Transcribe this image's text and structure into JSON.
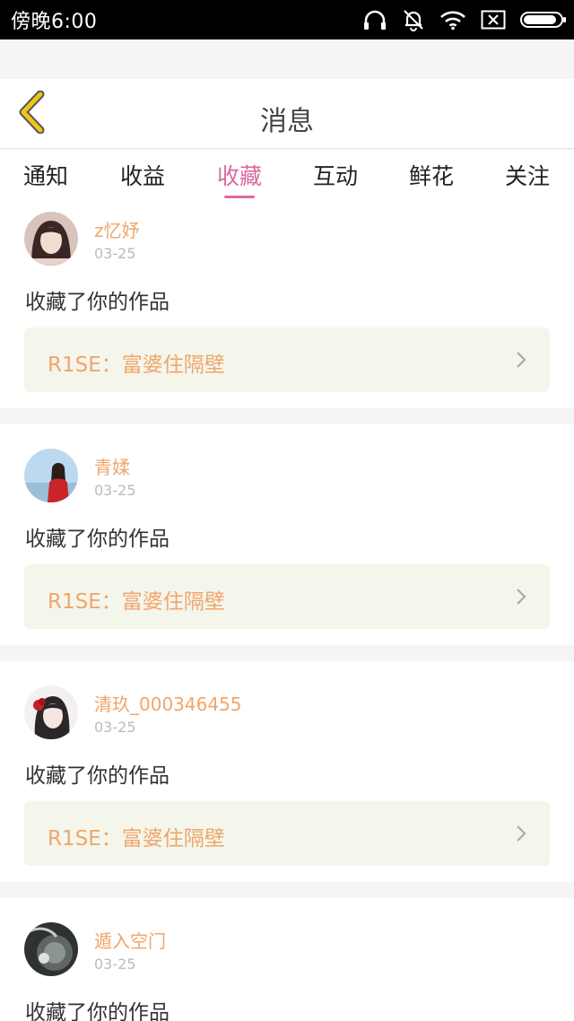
{
  "status_bar": {
    "time": "傍晚6:00",
    "icons": [
      "headphones-icon",
      "bell-muted-icon",
      "wifi-icon",
      "sim-none-icon",
      "battery-icon"
    ],
    "battery_level": 0.9
  },
  "header": {
    "title": "消息",
    "back_icon": "chevron-left-icon",
    "accent": "#f0c419"
  },
  "tabs": [
    {
      "label": "通知",
      "active": false
    },
    {
      "label": "收益",
      "active": false
    },
    {
      "label": "收藏",
      "active": true
    },
    {
      "label": "互动",
      "active": false
    },
    {
      "label": "鲜花",
      "active": false
    },
    {
      "label": "关注",
      "active": false
    }
  ],
  "colors": {
    "tab_active": "#d96aa0",
    "username": "#f0a66a",
    "work_title": "#f0a66a",
    "work_box_bg": "#f4f6ec"
  },
  "messages": [
    {
      "username": "z忆妤",
      "date": "03-25",
      "action": "收藏了你的作品",
      "work_title": "R1SE：富婆住隔壁"
    },
    {
      "username": "青媃",
      "date": "03-25",
      "action": "收藏了你的作品",
      "work_title": "R1SE：富婆住隔壁"
    },
    {
      "username": "清玖_000346455",
      "date": "03-25",
      "action": "收藏了你的作品",
      "work_title": "R1SE：富婆住隔壁"
    },
    {
      "username": "遁入空门",
      "date": "03-25",
      "action": "收藏了你的作品",
      "work_title": ""
    }
  ]
}
